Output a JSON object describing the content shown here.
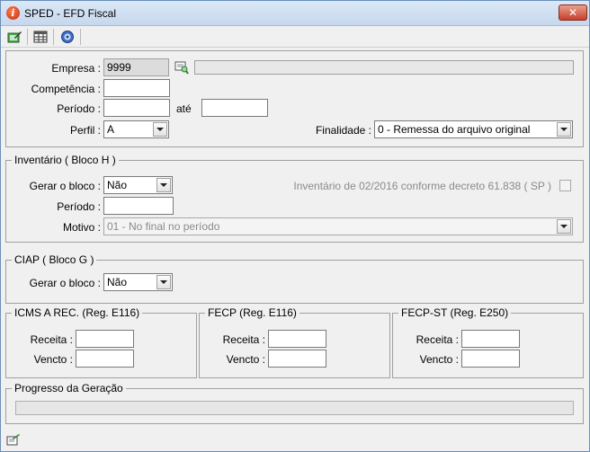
{
  "window": {
    "title": "SPED - EFD Fiscal",
    "close_label": "✕"
  },
  "form": {
    "empresa_label": "Empresa :",
    "empresa_value": "9999",
    "empresa_name": "",
    "competencia_label": "Competência :",
    "competencia_value": "",
    "periodo_label": "Período :",
    "periodo_start": "",
    "ate_label": "até",
    "periodo_end": "",
    "perfil_label": "Perfil :",
    "perfil_value": "A",
    "finalidade_label": "Finalidade :",
    "finalidade_value": "0 - Remessa do arquivo original"
  },
  "inventario": {
    "title": "Inventário ( Bloco H )",
    "gerar_label": "Gerar o bloco :",
    "gerar_value": "Não",
    "decreto_label": "Inventário de 02/2016 conforme decreto 61.838 ( SP )",
    "periodo_label": "Período :",
    "periodo_value": "",
    "motivo_label": "Motivo :",
    "motivo_value": "01 - No final no período"
  },
  "ciap": {
    "title": "CIAP ( Bloco G )",
    "gerar_label": "Gerar o bloco :",
    "gerar_value": "Não"
  },
  "icms": {
    "title": "ICMS A REC. (Reg. E116)",
    "receita_label": "Receita :",
    "vencto_label": "Vencto :"
  },
  "fecp": {
    "title": "FECP (Reg. E116)",
    "receita_label": "Receita :",
    "vencto_label": "Vencto :"
  },
  "fecpst": {
    "title": "FECP-ST (Reg. E250)",
    "receita_label": "Receita :",
    "vencto_label": "Vencto :"
  },
  "progresso": {
    "title": "Progresso da Geração",
    "value": 0
  },
  "colors": {
    "titlebar": "#c6d8ee",
    "close": "#c7402a",
    "group_border": "#a0a0a0"
  }
}
